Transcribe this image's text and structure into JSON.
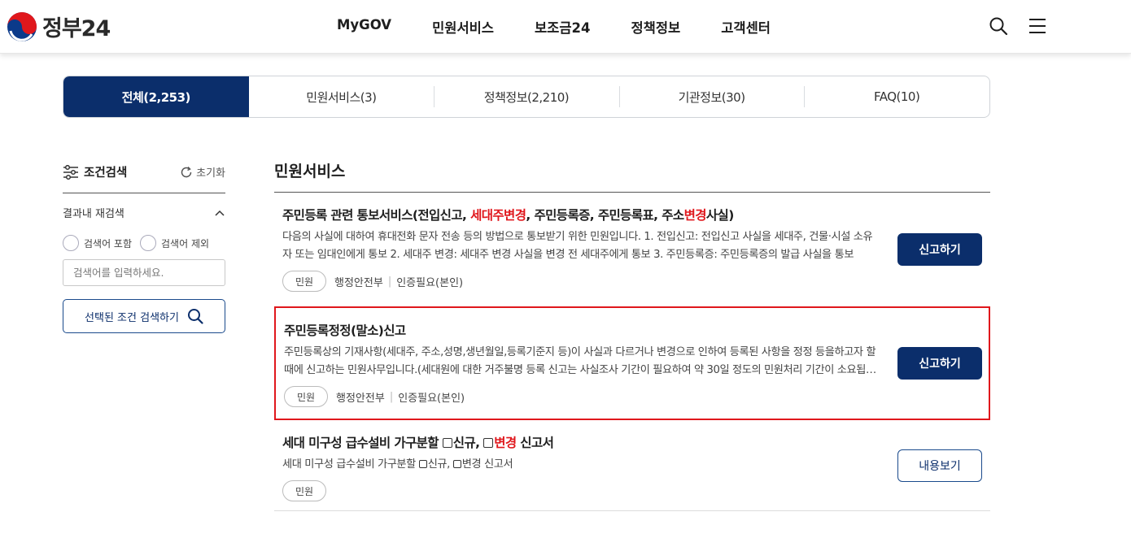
{
  "header": {
    "logo_text": "정부24",
    "nav": [
      "MyGOV",
      "민원서비스",
      "보조금24",
      "정책정보",
      "고객센터"
    ],
    "icons": [
      "search-icon",
      "menu-icon"
    ]
  },
  "tabs": [
    {
      "label": "전체(2,253)",
      "active": true
    },
    {
      "label": "민원서비스(3)",
      "active": false
    },
    {
      "label": "정책정보(2,210)",
      "active": false
    },
    {
      "label": "기관정보(30)",
      "active": false
    },
    {
      "label": "FAQ(10)",
      "active": false
    }
  ],
  "sidebar": {
    "title": "조건검색",
    "reset_label": "초기화",
    "refine_label": "결과내 재검색",
    "radio_include": "검색어 포함",
    "radio_exclude": "검색어 제외",
    "input_placeholder": "검색어를 입력하세요.",
    "search_button": "선택된 조건 검색하기"
  },
  "main": {
    "section_title": "민원서비스",
    "items": [
      {
        "title_parts": [
          "주민등록 관련 통보서비스(전입신고, ",
          "세대주변경",
          ", 주민등록증, 주민등록표, 주소",
          "변경",
          "사실)"
        ],
        "description": "다음의 사실에 대하여 휴대전화 문자 전송 등의 방법으로 통보받기 위한 민원입니다. 1. 전입신고: 전입신고 사실을 세대주, 건물·시설 소유자 또는 임대인에게 통보 2. 세대주 변경: 세대주 변경 사실을 변경 전 세대주에게 통보 3. 주민등록증: 주민등록증의 발급 사실을 통보",
        "badge": "민원",
        "agency": "행정안전부",
        "auth": "인증필요(본인)",
        "action": "신고하기"
      },
      {
        "title": "주민등록정정(말소)신고",
        "description": "주민등록상의 기재사항(세대주, 주소,성명,생년월일,등록기준지 등)이 사실과 다르거나 변경으로 인하여 등록된 사항을 정정 등을하고자 할 때에 신고하는 민원사무입니다.(세대원에 대한 거주불명 등록 신고는 사실조사 기간이 필요하여 약 30일 정도의 민원처리 기간이 소요됩니다.)",
        "badge": "민원",
        "agency": "행정안전부",
        "auth": "인증필요(본인)",
        "action": "신고하기"
      },
      {
        "title_parts": [
          "세대 미구성 급수설비 가구분할 ",
          "신규, ",
          "변경",
          " 신고서"
        ],
        "description_parts": [
          "세대 미구성 급수설비 가구분할 ",
          "신규, ",
          "변경 신고서"
        ],
        "badge": "민원",
        "action": "내용보기"
      }
    ]
  },
  "colors": {
    "primary": "#0b2e6b",
    "highlight": "#e0171c",
    "border": "#cfd3d8"
  }
}
